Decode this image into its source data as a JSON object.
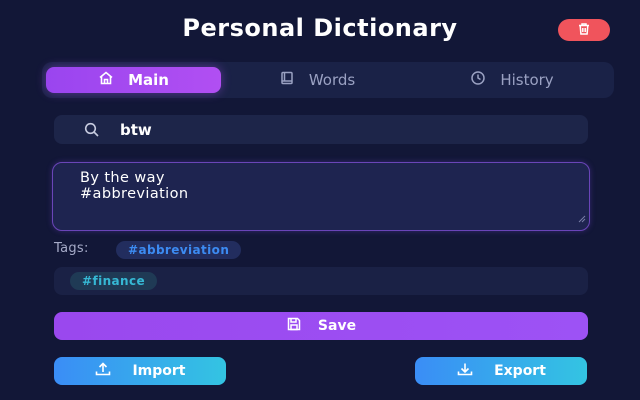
{
  "app": {
    "title": "Personal Dictionary"
  },
  "header": {
    "clear_icon": "trash-icon",
    "clear_color": "#f0545c"
  },
  "tabs": [
    {
      "label": "Main",
      "icon": "home-icon",
      "active": true
    },
    {
      "label": "Words",
      "icon": "book-icon",
      "active": false
    },
    {
      "label": "History",
      "icon": "clock-icon",
      "active": false
    }
  ],
  "search": {
    "value": "btw",
    "icon": "search-icon"
  },
  "definition": {
    "value": "By the way\n#abbreviation"
  },
  "tags": {
    "label": "Tags:",
    "selected": [
      "#abbreviation"
    ],
    "available": [
      "#finance"
    ]
  },
  "actions": {
    "save_label": "Save",
    "import_label": "Import",
    "export_label": "Export"
  },
  "colors": {
    "background": "#121737",
    "accent_purple": "#9a45ef",
    "accent_blue": "#3a8df6",
    "accent_cyan": "#33c4e2"
  }
}
